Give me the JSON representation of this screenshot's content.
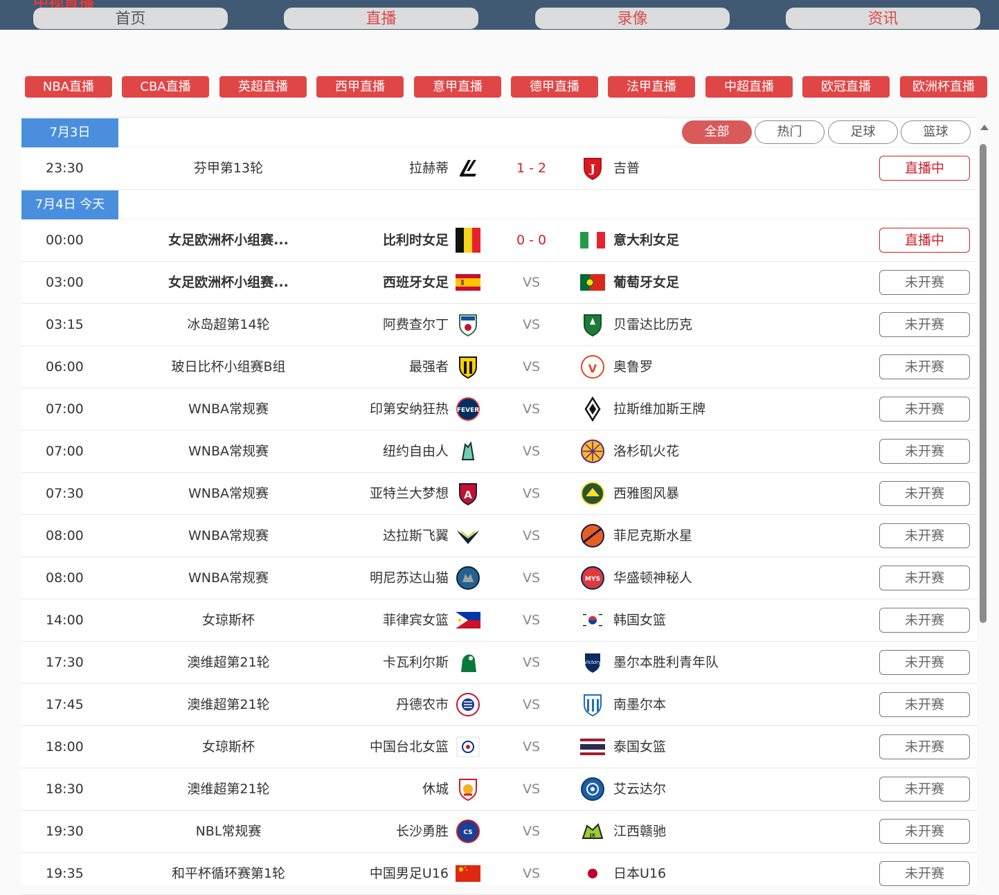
{
  "header": {
    "site_title": "中视直播",
    "nav": [
      {
        "label": "首页"
      },
      {
        "label": "直播"
      },
      {
        "label": "录像"
      },
      {
        "label": "资讯"
      }
    ]
  },
  "leagues": [
    {
      "label": "NBA直播"
    },
    {
      "label": "CBA直播"
    },
    {
      "label": "英超直播"
    },
    {
      "label": "西甲直播"
    },
    {
      "label": "意甲直播"
    },
    {
      "label": "德甲直播"
    },
    {
      "label": "法甲直播"
    },
    {
      "label": "中超直播"
    },
    {
      "label": "欧冠直播"
    },
    {
      "label": "欧洲杯直播"
    }
  ],
  "filters": [
    {
      "label": "全部",
      "active": true
    },
    {
      "label": "热门",
      "active": false
    },
    {
      "label": "足球",
      "active": false
    },
    {
      "label": "篮球",
      "active": false
    }
  ],
  "days": [
    {
      "date": "7月3日",
      "matches": [
        {
          "time": "23:30",
          "league": "芬甲第13轮",
          "home": "拉赫蒂",
          "home_logo": "lahti-logo",
          "score": "1 - 2",
          "away": "吉普",
          "away_logo": "jippo-logo",
          "status": "直播中",
          "live": true,
          "bold": false
        }
      ]
    },
    {
      "date": "7月4日 今天",
      "matches": [
        {
          "time": "00:00",
          "league": "女足欧洲杯小组赛...",
          "home": "比利时女足",
          "home_logo": "belgium-flag",
          "score": "0 - 0",
          "away": "意大利女足",
          "away_logo": "italy-flag",
          "status": "直播中",
          "live": true,
          "bold": true
        },
        {
          "time": "03:00",
          "league": "女足欧洲杯小组赛...",
          "home": "西班牙女足",
          "home_logo": "spain-flag",
          "score": "VS",
          "away": "葡萄牙女足",
          "away_logo": "portugal-flag",
          "status": "未开赛",
          "live": false,
          "bold": true
        },
        {
          "time": "03:15",
          "league": "冰岛超第14轮",
          "home": "阿费查尔丁",
          "home_logo": "afturelding-logo",
          "score": "VS",
          "away": "贝雷达比历克",
          "away_logo": "breidablik-logo",
          "status": "未开赛",
          "live": false,
          "bold": false
        },
        {
          "time": "06:00",
          "league": "玻日比杯小组赛B组",
          "home": "最强者",
          "home_logo": "the-strongest-logo",
          "score": "VS",
          "away": "奥鲁罗",
          "away_logo": "oruro-logo",
          "status": "未开赛",
          "live": false,
          "bold": false
        },
        {
          "time": "07:00",
          "league": "WNBA常规赛",
          "home": "印第安纳狂热",
          "home_logo": "indiana-fever-logo",
          "score": "VS",
          "away": "拉斯维加斯王牌",
          "away_logo": "las-vegas-aces-logo",
          "status": "未开赛",
          "live": false,
          "bold": false
        },
        {
          "time": "07:00",
          "league": "WNBA常规赛",
          "home": "纽约自由人",
          "home_logo": "ny-liberty-logo",
          "score": "VS",
          "away": "洛杉矶火花",
          "away_logo": "la-sparks-logo",
          "status": "未开赛",
          "live": false,
          "bold": false
        },
        {
          "time": "07:30",
          "league": "WNBA常规赛",
          "home": "亚特兰大梦想",
          "home_logo": "atlanta-dream-logo",
          "score": "VS",
          "away": "西雅图风暴",
          "away_logo": "seattle-storm-logo",
          "status": "未开赛",
          "live": false,
          "bold": false
        },
        {
          "time": "08:00",
          "league": "WNBA常规赛",
          "home": "达拉斯飞翼",
          "home_logo": "dallas-wings-logo",
          "score": "VS",
          "away": "菲尼克斯水星",
          "away_logo": "phoenix-mercury-logo",
          "status": "未开赛",
          "live": false,
          "bold": false
        },
        {
          "time": "08:00",
          "league": "WNBA常规赛",
          "home": "明尼苏达山猫",
          "home_logo": "minnesota-lynx-logo",
          "score": "VS",
          "away": "华盛顿神秘人",
          "away_logo": "washington-mystics-logo",
          "status": "未开赛",
          "live": false,
          "bold": false
        },
        {
          "time": "14:00",
          "league": "女琼斯杯",
          "home": "菲律宾女篮",
          "home_logo": "philippines-flag",
          "score": "VS",
          "away": "韩国女篮",
          "away_logo": "korea-flag",
          "status": "未开赛",
          "live": false,
          "bold": false
        },
        {
          "time": "17:30",
          "league": "澳维超第21轮",
          "home": "卡瓦利尔斯",
          "home_logo": "cavaliers-logo",
          "score": "VS",
          "away": "墨尔本胜利青年队",
          "away_logo": "melbourne-victory-logo",
          "status": "未开赛",
          "live": false,
          "bold": false
        },
        {
          "time": "17:45",
          "league": "澳维超第21轮",
          "home": "丹德农市",
          "home_logo": "dandenong-logo",
          "score": "VS",
          "away": "南墨尔本",
          "away_logo": "south-melbourne-logo",
          "status": "未开赛",
          "live": false,
          "bold": false
        },
        {
          "time": "18:00",
          "league": "女琼斯杯",
          "home": "中国台北女篮",
          "home_logo": "chinese-taipei-logo",
          "score": "VS",
          "away": "泰国女篮",
          "away_logo": "thailand-flag",
          "status": "未开赛",
          "live": false,
          "bold": false
        },
        {
          "time": "18:30",
          "league": "澳维超第21轮",
          "home": "休城",
          "home_logo": "hume-city-logo",
          "score": "VS",
          "away": "艾云达尔",
          "away_logo": "avondale-logo",
          "status": "未开赛",
          "live": false,
          "bold": false
        },
        {
          "time": "19:30",
          "league": "NBL常规赛",
          "home": "长沙勇胜",
          "home_logo": "changsha-logo",
          "score": "VS",
          "away": "江西赣驰",
          "away_logo": "jiangxi-logo",
          "status": "未开赛",
          "live": false,
          "bold": false
        },
        {
          "time": "19:35",
          "league": "和平杯循环赛第1轮",
          "home": "中国男足U16",
          "home_logo": "china-flag",
          "score": "VS",
          "away": "日本U16",
          "away_logo": "japan-flag",
          "status": "未开赛",
          "live": false,
          "bold": false
        }
      ]
    }
  ]
}
